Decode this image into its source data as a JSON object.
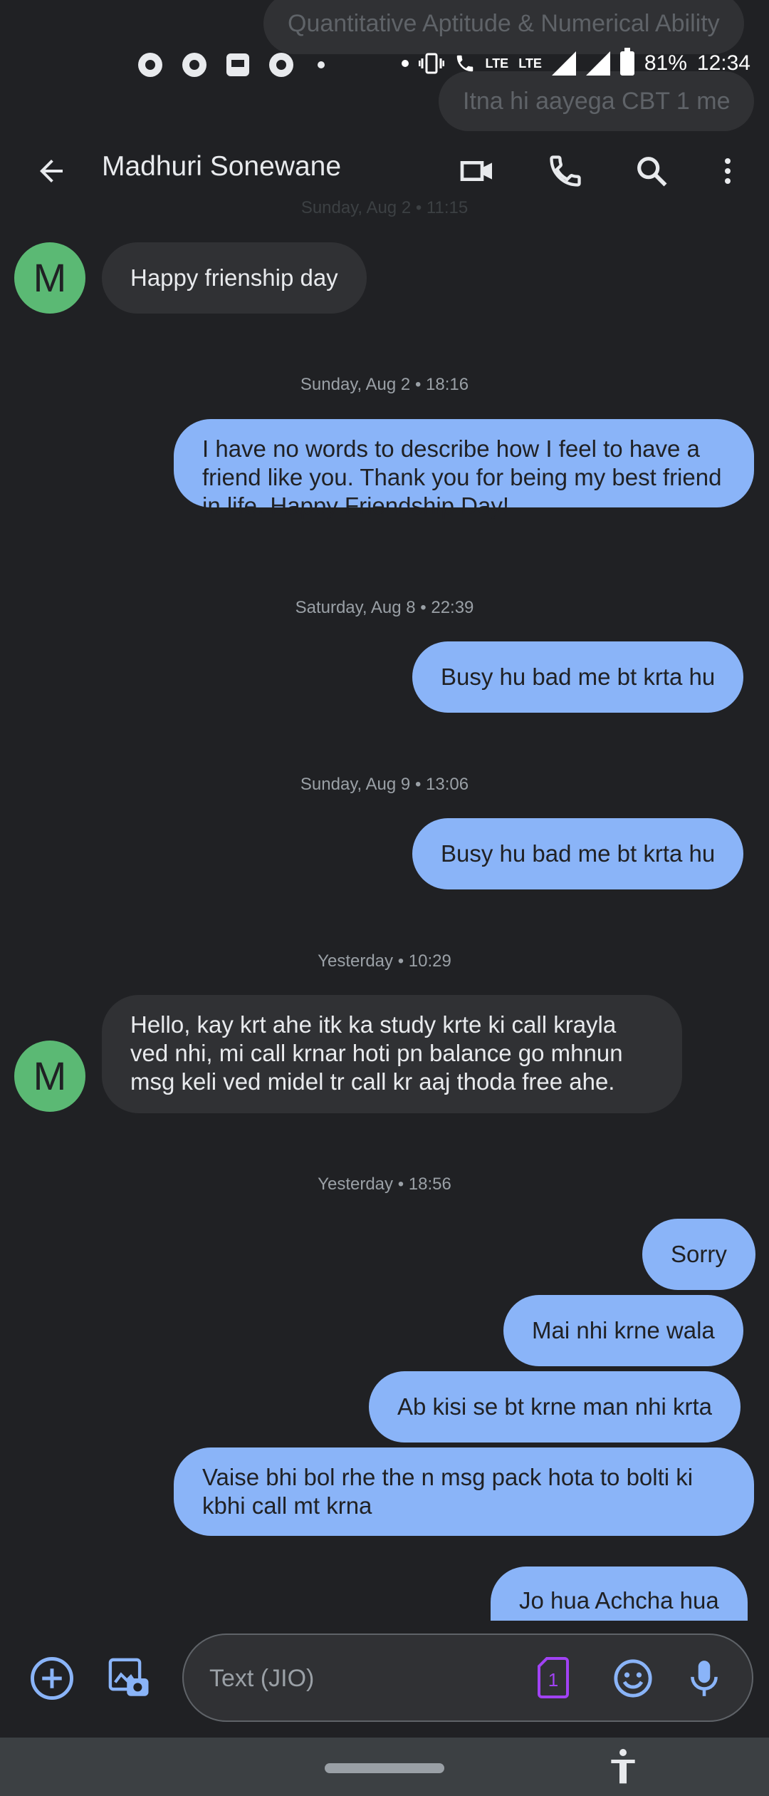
{
  "ghost_messages": [
    "Quantitative Aptitude & Numerical Ability",
    "Itna hi aayega CBT 1 me"
  ],
  "status_bar": {
    "lte1": "LTE",
    "lte2": "LTE",
    "battery": "81%",
    "time": "12:34"
  },
  "header": {
    "title": "Madhuri Sonewane"
  },
  "conversation": {
    "faded_timestamp": "Sunday, Aug 2 • 11:15",
    "avatar_initial": "M",
    "messages": [
      {
        "text": "Happy frienship day"
      },
      {
        "text": "I have no words to describe how I feel to have a friend like you. Thank you for being my best friend in life. Happy Friendship Day!"
      },
      {
        "text": "Busy hu bad me bt krta hu"
      },
      {
        "text": "Busy hu bad me bt krta hu"
      },
      {
        "text": "Hello, kay krt ahe itk ka study krte ki call krayla ved nhi, mi call krnar hoti pn balance go mhnun msg keli ved midel tr call kr aaj thoda free ahe."
      },
      {
        "text": "Sorry"
      },
      {
        "text": "Mai nhi krne wala"
      },
      {
        "text": "Ab kisi se bt krne man nhi krta"
      },
      {
        "text": "Vaise bhi bol rhe the n msg pack hota to bolti ki kbhi call mt krna"
      },
      {
        "text": "Jo hua Achcha hua"
      }
    ],
    "timestamps": [
      "Sunday, Aug 2 • 18:16",
      "Saturday, Aug 8 • 22:39",
      "Sunday, Aug 9 • 13:06",
      "Yesterday • 10:29",
      "Yesterday • 18:56"
    ]
  },
  "composer": {
    "placeholder": "Text (JIO)",
    "sim_number": "1"
  },
  "colors": {
    "background": "#202124",
    "incoming_bubble": "#303134",
    "outgoing_bubble": "#8ab4f8",
    "avatar": "#5bb974",
    "accent": "#8ab4f8",
    "sim_icon": "#a142f4"
  }
}
